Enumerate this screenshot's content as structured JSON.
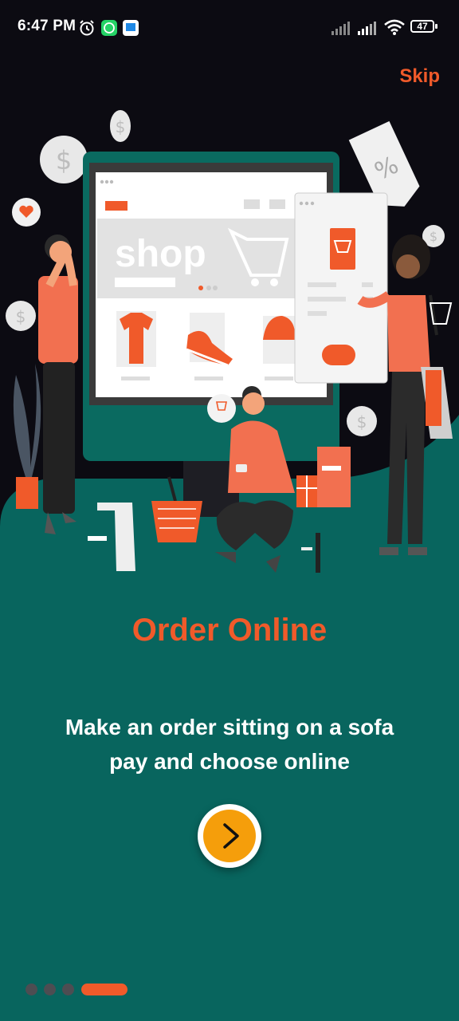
{
  "status_bar": {
    "time": "6:47 PM",
    "battery": "47",
    "icons": [
      "alarm-icon",
      "whatsapp-icon",
      "app-notification-icon",
      "signal-icon",
      "signal-icon",
      "wifi-icon",
      "battery-icon"
    ]
  },
  "header": {
    "skip_label": "Skip"
  },
  "illustration": {
    "screen_word": "shop"
  },
  "onboarding": {
    "title": "Order Online",
    "description_line1": "Make an order sitting on a sofa",
    "description_line2": "pay and choose online"
  },
  "pagination": {
    "count": 4,
    "active_index": 3
  },
  "colors": {
    "accent": "#f05a2a",
    "teal": "#08655e",
    "next_button": "#f59e0b",
    "background": "#0c0b12"
  }
}
